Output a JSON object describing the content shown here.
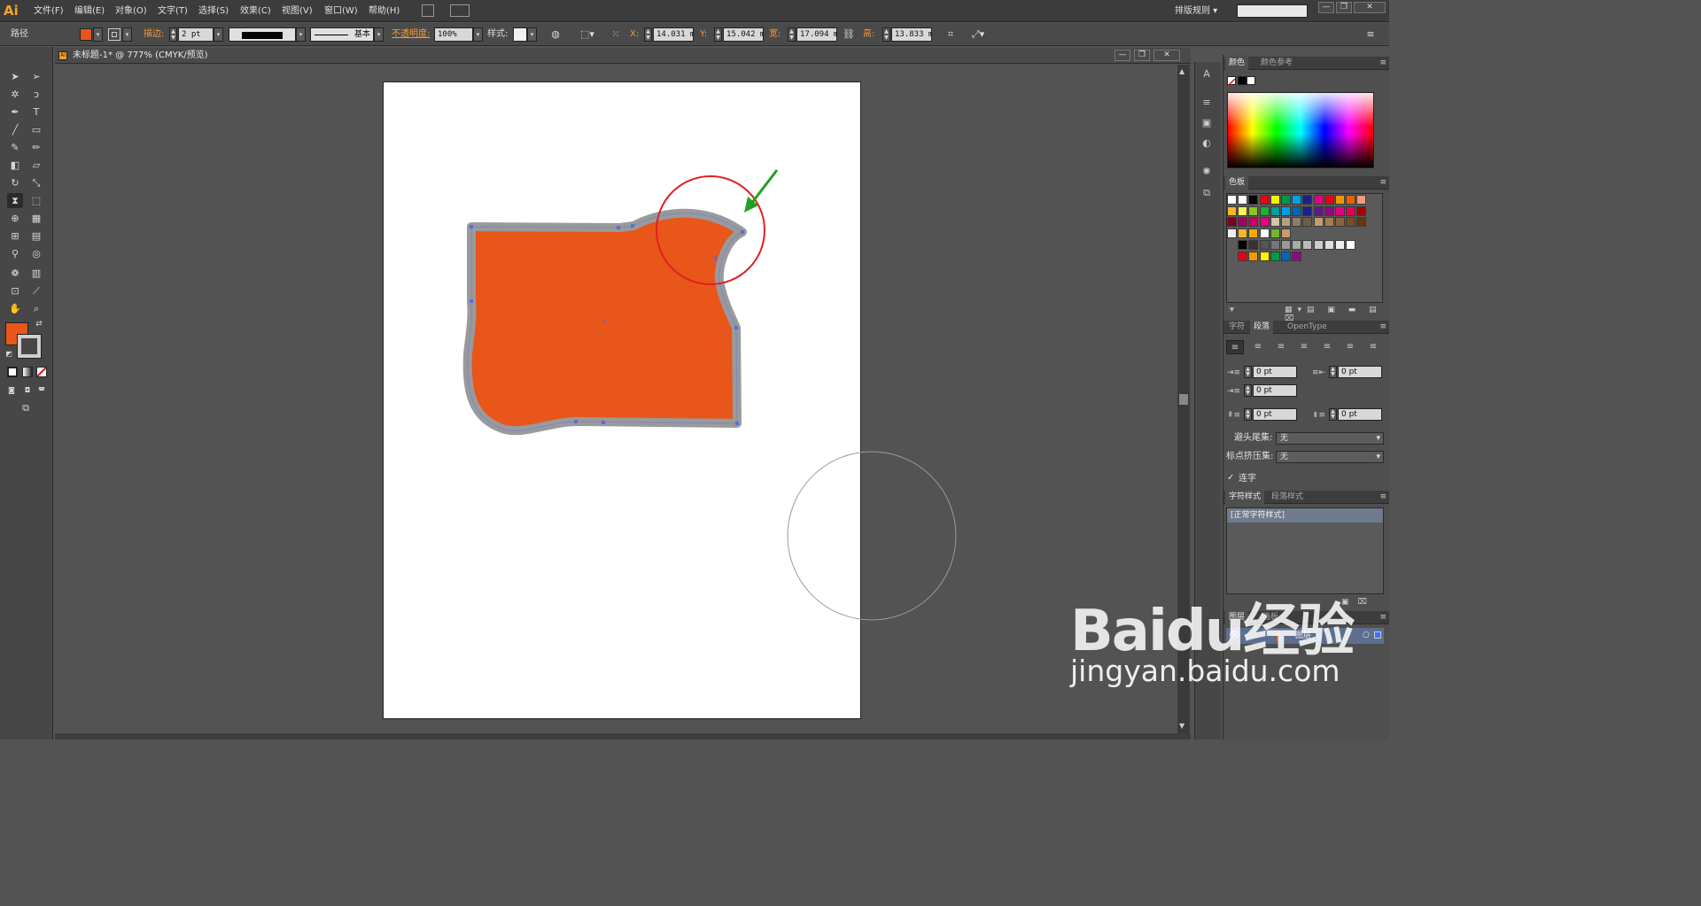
{
  "app": {
    "logo": "Ai",
    "workspace": "排版规则 ▾"
  },
  "menu": [
    "文件(F)",
    "编辑(E)",
    "对象(O)",
    "文字(T)",
    "选择(S)",
    "效果(C)",
    "视图(V)",
    "窗口(W)",
    "帮助(H)"
  ],
  "window_controls": [
    "—",
    "❐",
    "✕"
  ],
  "control_bar": {
    "selection_label": "路径",
    "fill_color": "#e8561a",
    "stroke_label": "描边:",
    "stroke_weight": "2 pt",
    "stroke_profile": "基本",
    "opacity_label": "不透明度:",
    "opacity_value": "100%",
    "style_label": "样式:",
    "x_label": "X:",
    "x_value": "14.031 mm",
    "y_label": "Y:",
    "y_value": "15.042 mm",
    "w_label": "宽:",
    "w_value": "17.094 mm",
    "h_label": "高:",
    "h_value": "13.833 mm"
  },
  "document": {
    "title": "未标题-1* @ 777% (CMYK/预览)",
    "shape_fill": "#e8561a",
    "shape_stroke": "#9a9a9a",
    "annotation_circle_color": "#e02020",
    "arrow_color": "#22a022"
  },
  "panels": {
    "color": {
      "tabs": [
        "颜色",
        "颜色参考"
      ]
    },
    "swatches": {
      "tab": "色板"
    },
    "type": {
      "tabs": [
        "字符",
        "段落",
        "OpenType"
      ]
    },
    "paragraph": {
      "left_indent": "0 pt",
      "right_indent": "0 pt",
      "first_indent": "0 pt",
      "space_before": "0 pt",
      "space_after": "0 pt",
      "hyphen_label": "避头尾集:",
      "hyphen_value": "无",
      "punct_label": "标点挤压集:",
      "punct_value": "无",
      "hyphenate_label": "连字"
    },
    "char_styles": {
      "tabs": [
        "字符样式",
        "段落样式"
      ],
      "item": "[正常字符样式]"
    },
    "layers": {
      "tabs": [
        "图层",
        "画板"
      ],
      "layer_name": "图层 1"
    }
  },
  "watermark": {
    "line1": "Baidu经验",
    "line2": "jingyan.baidu.com"
  }
}
